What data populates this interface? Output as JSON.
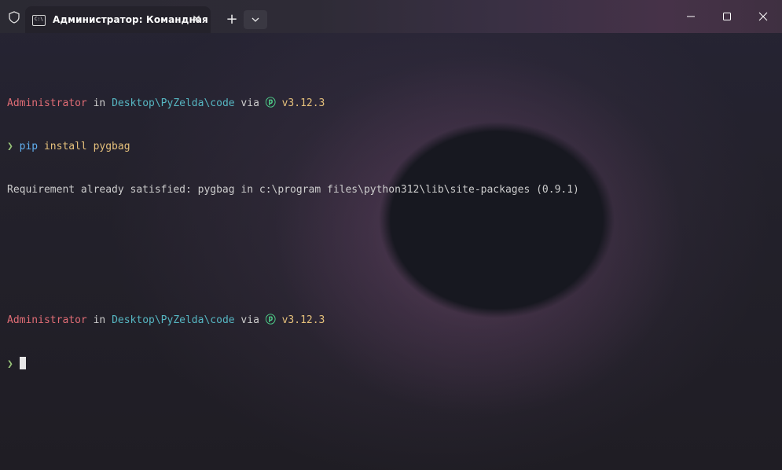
{
  "window": {
    "tab_title": "Администратор: Командная",
    "tab_icon_text": "C:\\",
    "new_tab_glyph": "+",
    "close_tab_glyph": "✕"
  },
  "terminal": {
    "prompt1": {
      "user": "Administrator",
      "in": " in ",
      "path": "Desktop\\PyZelda\\code",
      "via": " via ",
      "python_icon": "ⓟ",
      "version": " v3.12.3"
    },
    "command1": {
      "arrow": "❯",
      "cmd": " pip",
      "args": " install pygbag"
    },
    "output1": "Requirement already satisfied: pygbag in c:\\program files\\python312\\lib\\site-packages (0.9.1)",
    "prompt2": {
      "user": "Administrator",
      "in": " in ",
      "path": "Desktop\\PyZelda\\code",
      "via": " via ",
      "python_icon": "ⓟ",
      "version": " v3.12.3"
    },
    "command2": {
      "arrow": "❯ "
    }
  },
  "colors": {
    "user": "#e06c75",
    "path": "#56b6c2",
    "version": "#e5c07b",
    "arrow": "#98c379",
    "cmd": "#61afef"
  }
}
